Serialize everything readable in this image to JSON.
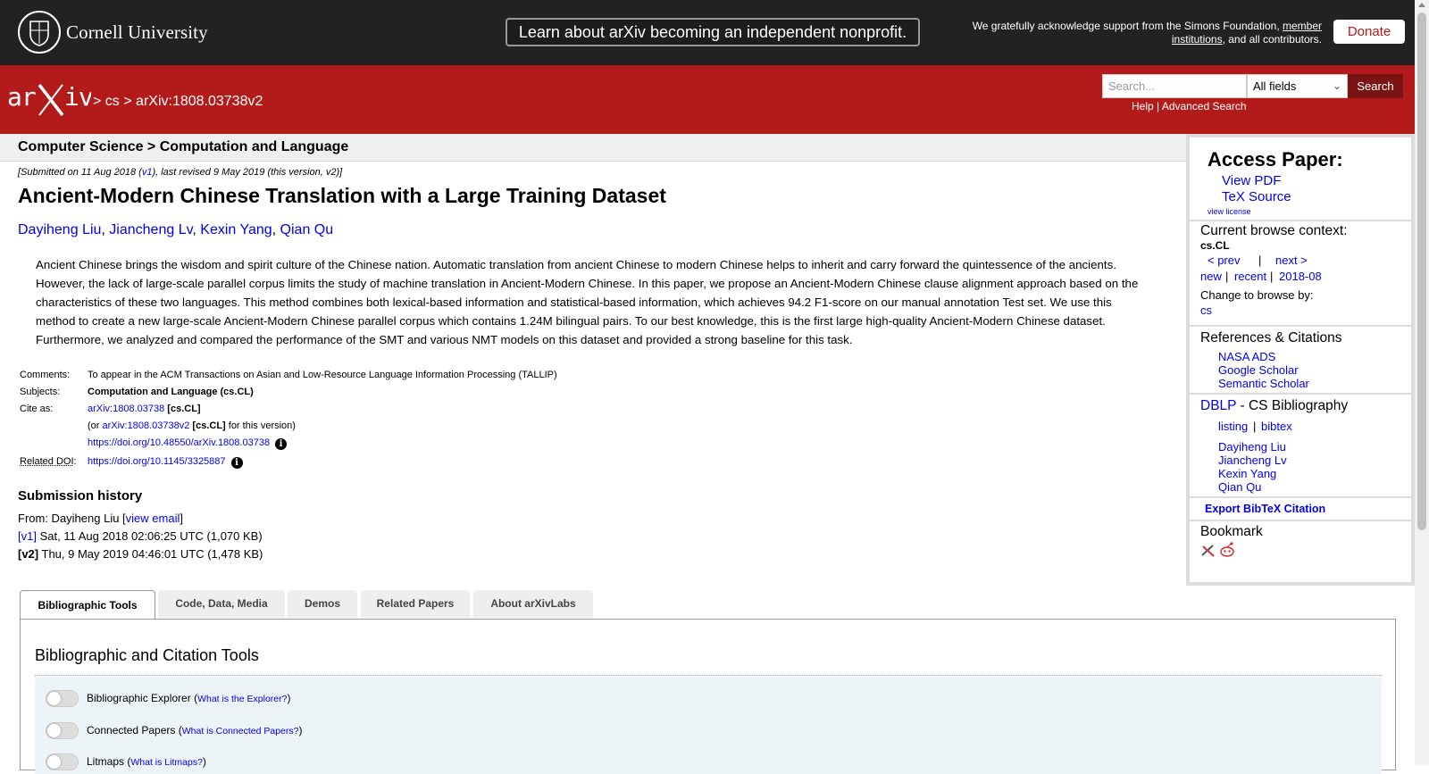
{
  "topbar": {
    "cornell_name": "Cornell University",
    "nonprofit_label": "Learn about arXiv becoming an independent nonprofit.",
    "support_prefix": "We gratefully acknowledge support from the Simons Foundation, ",
    "support_link": "member institutions",
    "support_suffix": ", and all contributors.",
    "donate_label": "Donate"
  },
  "header": {
    "crumb_sep1": ">",
    "crumb_cs": "cs",
    "crumb_sep2": ">",
    "crumb_id": "arXiv:1808.03738v2",
    "search_placeholder": "Search...",
    "field_selected": "All fields",
    "search_label": "Search",
    "help_label": "Help",
    "sep": "|",
    "advanced_label": "Advanced Search"
  },
  "paper": {
    "category": "Computer Science > Computation and Language",
    "date_prefix": "[Submitted on 11 Aug 2018 (",
    "date_v1": "v1",
    "date_suffix": "), last revised 9 May 2019 (this version, v2)]",
    "title": "Ancient-Modern Chinese Translation with a Large Training Dataset",
    "authors": [
      "Dayiheng Liu",
      "Jiancheng Lv",
      "Kexin Yang",
      "Qian Qu"
    ],
    "abstract": "Ancient Chinese brings the wisdom and spirit culture of the Chinese nation. Automatic translation from ancient Chinese to modern Chinese helps to inherit and carry forward the quintessence of the ancients. However, the lack of large-scale parallel corpus limits the study of machine translation in Ancient-Modern Chinese. In this paper, we propose an Ancient-Modern Chinese clause alignment approach based on the characteristics of these two languages. This method combines both lexical-based information and statistical-based information, which achieves 94.2 F1-score on our manual annotation Test set. We use this method to create a new large-scale Ancient-Modern Chinese parallel corpus which contains 1.24M bilingual pairs. To our best knowledge, this is the first large high-quality Ancient-Modern Chinese dataset. Furthermore, we analyzed and compared the performance of the SMT and various NMT models on this dataset and provided a strong baseline for this task."
  },
  "meta": {
    "comments_label": "Comments:",
    "comments": "To appear in the ACM Transactions on Asian and Low-Resource Language Information Processing (TALLIP)",
    "subjects_label": "Subjects:",
    "subjects": "Computation and Language (cs.CL)",
    "cite_label": "Cite as:",
    "cite_id": "arXiv:1808.03738",
    "cite_cat": "[cs.CL]",
    "cite_or": "(or ",
    "cite_v2": "arXiv:1808.03738v2",
    "cite_v2_cat": "[cs.CL]",
    "cite_v2_suffix": " for this version)",
    "doi": "https://doi.org/10.48550/arXiv.1808.03738",
    "related_label": "Related DOI",
    "related_colon": ":",
    "related_doi": "https://doi.org/10.1145/3325887"
  },
  "history": {
    "title": "Submission history",
    "from_prefix": "From: Dayiheng Liu [",
    "view_email": "view email",
    "from_suffix": "]",
    "v1_label": "[v1]",
    "v1_text": " Sat, 11 Aug 2018 02:06:25 UTC (1,070 KB)",
    "v2_label": "[v2]",
    "v2_text": " Thu, 9 May 2019 04:46:01 UTC (1,478 KB)"
  },
  "sidebar": {
    "access_title": "Access Paper:",
    "view_pdf": "View PDF",
    "tex_source": "TeX Source",
    "view_license": "view license",
    "context_title": "Current browse context:",
    "context_value": "cs.CL",
    "prev": "< prev",
    "sep": "|",
    "next": "next >",
    "new": "new",
    "recent": "recent",
    "month": "2018-08",
    "change_label": "Change to browse by:",
    "browse_cs": "cs",
    "refs_title": "References & Citations",
    "nasa": "NASA ADS",
    "google": "Google Scholar",
    "semantic": "Semantic Scholar",
    "dblp": "DBLP",
    "dblp_suffix": " - CS Bibliography",
    "listing": "listing",
    "bibtex": "bibtex",
    "dblp_authors": [
      "Dayiheng Liu",
      "Jiancheng Lv",
      "Kexin Yang",
      "Qian Qu"
    ],
    "export": "Export BibTeX Citation",
    "bookmark_title": "Bookmark"
  },
  "tabs": {
    "items": [
      "Bibliographic Tools",
      "Code, Data, Media",
      "Demos",
      "Related Papers",
      "About arXivLabs"
    ],
    "tools_title": "Bibliographic and Citation Tools",
    "toggles": [
      {
        "label": "Bibliographic Explorer",
        "q": "What is the Explorer?"
      },
      {
        "label": "Connected Papers",
        "q": "What is Connected Papers?"
      },
      {
        "label": "Litmaps",
        "q": "What is Litmaps?"
      }
    ]
  },
  "colors": {
    "arxiv_red": "#b31b1b",
    "topbar": "#222222",
    "link": "#0000ee"
  }
}
